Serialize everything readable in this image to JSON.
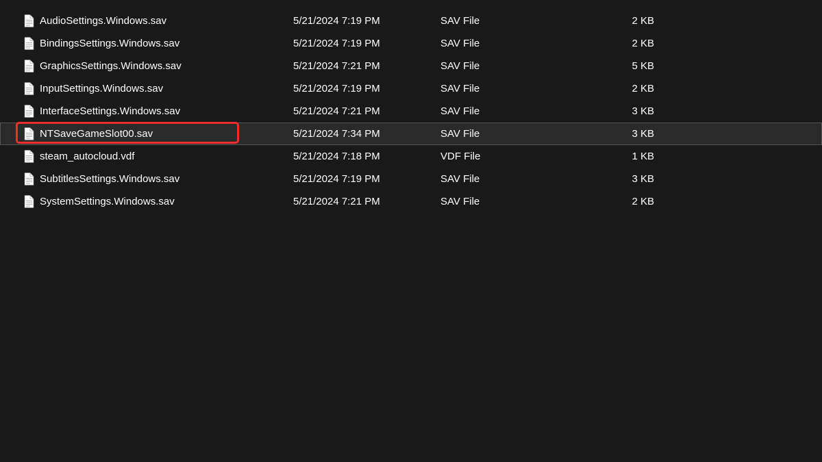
{
  "files": [
    {
      "name": "AudioSettings.Windows.sav",
      "date": "5/21/2024 7:19 PM",
      "type": "SAV File",
      "size": "2 KB",
      "selected": false,
      "highlighted": false
    },
    {
      "name": "BindingsSettings.Windows.sav",
      "date": "5/21/2024 7:19 PM",
      "type": "SAV File",
      "size": "2 KB",
      "selected": false,
      "highlighted": false
    },
    {
      "name": "GraphicsSettings.Windows.sav",
      "date": "5/21/2024 7:21 PM",
      "type": "SAV File",
      "size": "5 KB",
      "selected": false,
      "highlighted": false
    },
    {
      "name": "InputSettings.Windows.sav",
      "date": "5/21/2024 7:19 PM",
      "type": "SAV File",
      "size": "2 KB",
      "selected": false,
      "highlighted": false
    },
    {
      "name": "InterfaceSettings.Windows.sav",
      "date": "5/21/2024 7:21 PM",
      "type": "SAV File",
      "size": "3 KB",
      "selected": false,
      "highlighted": false
    },
    {
      "name": "NTSaveGameSlot00.sav",
      "date": "5/21/2024 7:34 PM",
      "type": "SAV File",
      "size": "3 KB",
      "selected": true,
      "highlighted": true
    },
    {
      "name": "steam_autocloud.vdf",
      "date": "5/21/2024 7:18 PM",
      "type": "VDF File",
      "size": "1 KB",
      "selected": false,
      "highlighted": false
    },
    {
      "name": "SubtitlesSettings.Windows.sav",
      "date": "5/21/2024 7:19 PM",
      "type": "SAV File",
      "size": "3 KB",
      "selected": false,
      "highlighted": false
    },
    {
      "name": "SystemSettings.Windows.sav",
      "date": "5/21/2024 7:21 PM",
      "type": "SAV File",
      "size": "2 KB",
      "selected": false,
      "highlighted": false
    }
  ]
}
